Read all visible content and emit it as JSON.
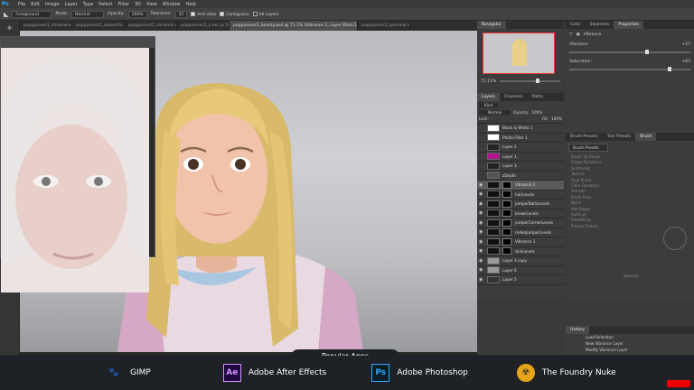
{
  "menu": {
    "logo": "Ps",
    "items": [
      "File",
      "Edit",
      "Image",
      "Layer",
      "Type",
      "Select",
      "Filter",
      "3D",
      "View",
      "Window",
      "Help"
    ]
  },
  "options": {
    "preset": "Foreground",
    "mode_label": "Mode:",
    "mode": "Normal",
    "opacity_label": "Opacity:",
    "opacity": "100%",
    "tolerance_label": "Tolerance:",
    "tolerance": "32",
    "antialias": "Anti-alias",
    "contiguous": "Contiguous",
    "all_layers": "All Layers"
  },
  "tabs": [
    "poppylovez1_shadow.exr @ 46.",
    "poppylovez1_subsurface.exr @",
    "poppylovez1_variance.exr @ 46.",
    "poppylovez1_z.exr @ 50% (Gray",
    "poppylovez1_beauty.psd @ 71.1% (Vibrance 2, Layer Mask/16) *",
    "poppylovez1_specular.exr"
  ],
  "navigator": {
    "title": "Navigator",
    "zoom": "71.11%"
  },
  "properties": {
    "tabs": [
      "Color",
      "Swatches",
      "Properties"
    ],
    "title": "Vibrance",
    "vibrance_label": "Vibrance:",
    "vibrance_value": "+27",
    "saturation_label": "Saturation:",
    "saturation_value": "+63"
  },
  "layers": {
    "tabs": [
      "Layers",
      "Channels",
      "Paths"
    ],
    "kind": "Kind",
    "blend": "Normal",
    "opacity_label": "Opacity:",
    "opacity": "100%",
    "lock_label": "Lock:",
    "fill_label": "Fill:",
    "fill": "100%",
    "rows": [
      "Black & White 1",
      "Photo Filter 1",
      "Layer 2",
      "Layer 1",
      "Layer 3",
      "zDepth",
      "Vibrance 2",
      "hairLevels",
      "jumperBallsLevels",
      "browsLevels",
      "jumperCornerLevels",
      "rodeoJumperLevels",
      "Vibrance 1",
      "skinLevels",
      "Layer 3 copy",
      "Layer 6",
      "Layer 5"
    ]
  },
  "brush": {
    "tabs": [
      "Brush Presets",
      "Tool Presets",
      "Brush"
    ],
    "presets_btn": "Brush Presets",
    "options": [
      "Brush Tip Shape",
      "Shape Dynamics",
      "Scattering",
      "Texture",
      "Dual Brush",
      "Color Dynamics",
      "Transfer",
      "Brush Pose",
      "Noise",
      "Wet Edges",
      "Build-up",
      "Smoothing",
      "Protect Texture"
    ],
    "spacing": "Spacing"
  },
  "history": {
    "title": "History",
    "items": [
      "Load Selection",
      "New Vibrance Layer",
      "Modify Vibrance Layer"
    ]
  },
  "bottom": {
    "popular": "Popular Apps",
    "apps": [
      {
        "icon": "GIMP",
        "name": "GIMP"
      },
      {
        "icon": "Ae",
        "name": "Adobe After Effects"
      },
      {
        "icon": "Ps",
        "name": "Adobe Photoshop"
      },
      {
        "icon": "Nuke",
        "name": "The Foundry Nuke"
      }
    ]
  }
}
